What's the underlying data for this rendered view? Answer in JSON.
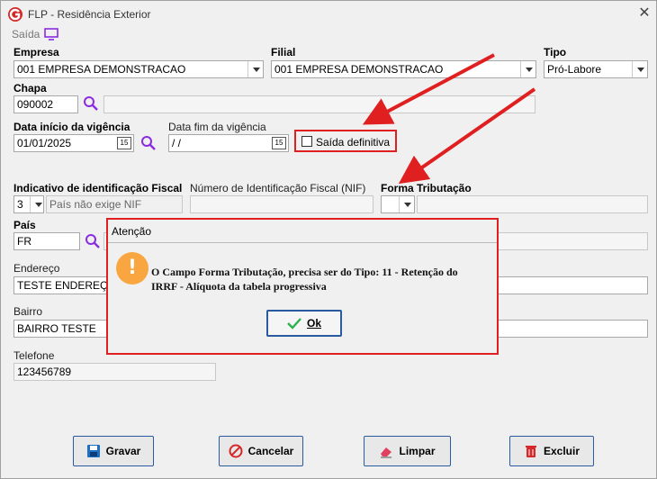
{
  "window": {
    "title": "FLP - Residência Exterior",
    "close_icon": "close-icon"
  },
  "toolbar": {
    "saida_label": "Saída",
    "saida_icon": "monitor-icon"
  },
  "form": {
    "empresa": {
      "label": "Empresa",
      "value": "001 EMPRESA DEMONSTRACAO"
    },
    "filial": {
      "label": "Filial",
      "value": "001 EMPRESA DEMONSTRACAO"
    },
    "tipo": {
      "label": "Tipo",
      "value": "Pró-Labore"
    },
    "chapa": {
      "label": "Chapa",
      "value": "090002",
      "name_value": ""
    },
    "data_inicio": {
      "label": "Data início da vigência",
      "value": "01/01/2025"
    },
    "data_fim": {
      "label": "Data fim da vigência",
      "value": " /  /"
    },
    "saida_definitiva": {
      "label": "Saída definitiva",
      "checked": false
    },
    "indicativo": {
      "label": "Indicativo de identificação Fiscal",
      "code": "3",
      "desc": "País não exige NIF"
    },
    "nif": {
      "label": "Número de Identificação Fiscal (NIF)",
      "value": ""
    },
    "forma_tributacao": {
      "label": "Forma Tributação",
      "value": ""
    },
    "pais": {
      "label": "País",
      "value": "FR"
    },
    "endereco": {
      "label": "Endereço",
      "value": "TESTE ENDEREÇO"
    },
    "bairro": {
      "label": "Bairro",
      "value": "BAIRRO TESTE"
    },
    "telefone": {
      "label": "Telefone",
      "value": "123456789"
    }
  },
  "buttons": {
    "gravar": "Gravar",
    "cancelar": "Cancelar",
    "limpar": "Limpar",
    "excluir": "Excluir"
  },
  "dialog": {
    "title": "Atenção",
    "icon": "!",
    "message": "O Campo Forma Tributação, precisa ser do Tipo: 11 - Retenção do IRRF - Alíquota da tabela progressiva",
    "ok_label": "Ok"
  },
  "colors": {
    "annotation_red": "#e02020",
    "accent_blue": "#2a5aa0",
    "warning_orange": "#f9a640",
    "search_purple": "#8a2be2"
  }
}
